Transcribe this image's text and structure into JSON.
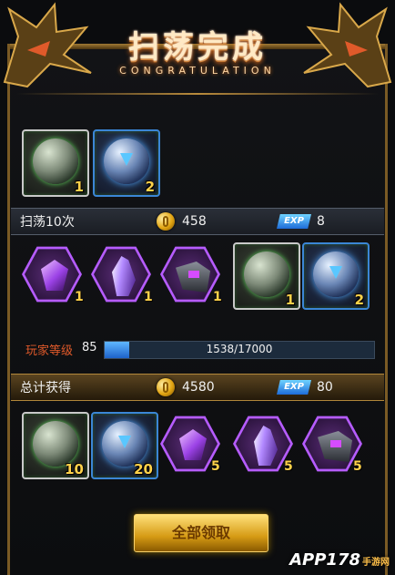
{
  "header": {
    "title": "扫荡完成",
    "subtitle": "CONGRATULATION"
  },
  "first_drops": [
    {
      "type": "green-orb",
      "qty": "1"
    },
    {
      "type": "blue-orb",
      "qty": "2"
    }
  ],
  "sweep_bar": {
    "label": "扫荡10次",
    "gold": "458",
    "exp_badge": "EXP",
    "exp": "8"
  },
  "sweep_drops": [
    {
      "type": "purple-gem",
      "qty": "1"
    },
    {
      "type": "purple-crystal",
      "qty": "1"
    },
    {
      "type": "purple-armor",
      "qty": "1"
    },
    {
      "type": "green-orb",
      "qty": "1"
    },
    {
      "type": "blue-orb",
      "qty": "2"
    }
  ],
  "level": {
    "label": "玩家等级",
    "value": "85",
    "progress_text": "1538/17000",
    "progress_fraction": 0.0905
  },
  "total_bar": {
    "label": "总计获得",
    "gold": "4580",
    "exp_badge": "EXP",
    "exp": "80"
  },
  "total_drops": [
    {
      "type": "green-orb",
      "qty": "10"
    },
    {
      "type": "blue-orb",
      "qty": "20"
    },
    {
      "type": "purple-gem",
      "qty": "5"
    },
    {
      "type": "purple-crystal",
      "qty": "5"
    },
    {
      "type": "purple-armor",
      "qty": "5"
    }
  ],
  "claim_button": {
    "label": "全部领取"
  },
  "watermark": {
    "text": "APP178",
    "sub": "手游网"
  },
  "colors": {
    "gold": "#ffd24a",
    "accent_orange": "#e05a2a",
    "purple_frame": "#b65cff",
    "green_frame": "#3f8f45",
    "blue_frame": "#3b86d6"
  }
}
